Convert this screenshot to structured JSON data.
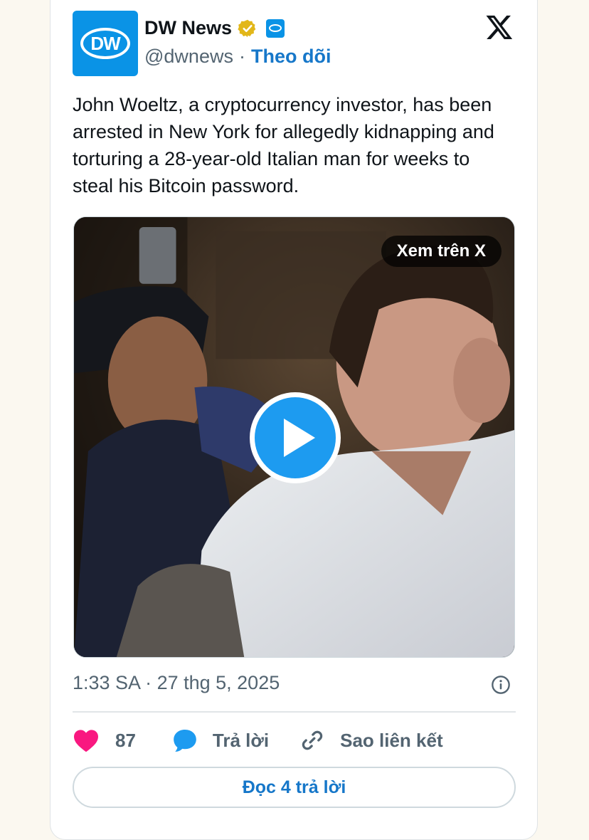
{
  "author": {
    "name": "DW News",
    "handle": "@dwnews",
    "separator": "·",
    "follow_label": "Theo dõi",
    "avatar_text": "DW"
  },
  "tweet": {
    "text": "John Woeltz, a cryptocurrency investor, has been arrested in New York for allegedly kidnapping and torturing a 28-year-old Italian man for weeks to steal his Bitcoin password.",
    "timestamp": "1:33 SA · 27 thg 5, 2025"
  },
  "media": {
    "view_on_x_label": "Xem trên X",
    "play_icon": "play-icon"
  },
  "actions": {
    "like_count": "87",
    "reply_label": "Trả lời",
    "copy_link_label": "Sao liên kết"
  },
  "read_replies_label": "Đọc 4 trả lời",
  "colors": {
    "brand_blue": "#0a93e6",
    "link_blue": "#1677c9",
    "like_pink": "#f91880",
    "reply_blue": "#1d9bf0",
    "verified_gold": "#e2b719",
    "text_primary": "#0f1419",
    "text_secondary": "#536471"
  }
}
